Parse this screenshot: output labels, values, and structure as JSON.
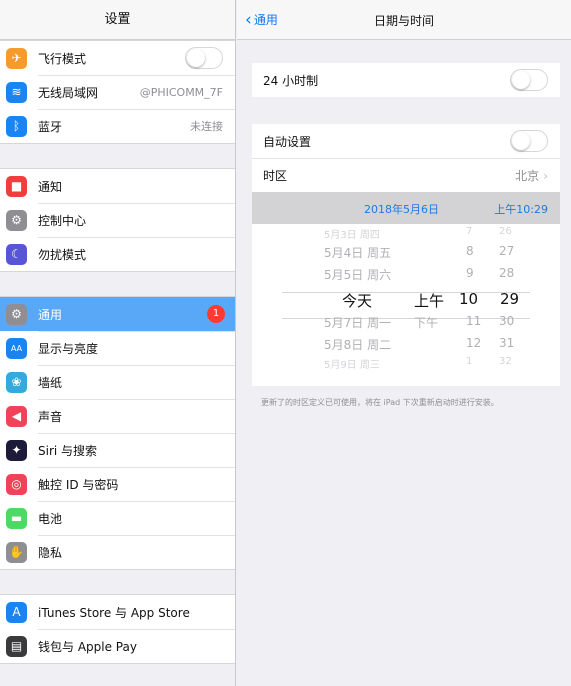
{
  "left": {
    "title": "设置",
    "groups": [
      [
        {
          "label": "飞行模式",
          "icon": "airplane-icon",
          "color": "#f59b2e",
          "glyph": "✈",
          "toggle": true
        },
        {
          "label": "无线局域网",
          "icon": "wifi-icon",
          "color": "#1a84f2",
          "glyph": "≋",
          "value": "@PHICOMM_7F"
        },
        {
          "label": "蓝牙",
          "icon": "bluetooth-icon",
          "color": "#1a84f2",
          "glyph": "ᛒ",
          "value": "未连接"
        }
      ],
      [
        {
          "label": "通知",
          "icon": "notifications-icon",
          "color": "#f03d3d",
          "glyph": "■"
        },
        {
          "label": "控制中心",
          "icon": "control-center-icon",
          "color": "#8e8e93",
          "glyph": "⚙"
        },
        {
          "label": "勿扰模式",
          "icon": "do-not-disturb-icon",
          "color": "#5856d6",
          "glyph": "☾"
        }
      ],
      [
        {
          "label": "通用",
          "icon": "general-icon",
          "color": "#8e8e93",
          "glyph": "⚙",
          "badge": "1",
          "selected": true
        },
        {
          "label": "显示与亮度",
          "icon": "display-brightness-icon",
          "color": "#1a84f2",
          "glyph": "AA"
        },
        {
          "label": "墙纸",
          "icon": "wallpaper-icon",
          "color": "#34aadc",
          "glyph": "❀"
        },
        {
          "label": "声音",
          "icon": "sounds-icon",
          "color": "#f0435a",
          "glyph": "◀"
        },
        {
          "label": "Siri 与搜索",
          "icon": "siri-icon",
          "color": "#1c1c3a",
          "glyph": "✦"
        },
        {
          "label": "触控 ID 与密码",
          "icon": "touch-id-icon",
          "color": "#f0435a",
          "glyph": "◎"
        },
        {
          "label": "电池",
          "icon": "battery-icon",
          "color": "#4cd964",
          "glyph": "▬"
        },
        {
          "label": "隐私",
          "icon": "privacy-icon",
          "color": "#8e8e93",
          "glyph": "✋"
        }
      ],
      [
        {
          "label": "iTunes Store 与 App Store",
          "icon": "app-store-icon",
          "color": "#1a84f2",
          "glyph": "A"
        },
        {
          "label": "钱包与 Apple Pay",
          "icon": "wallet-icon",
          "color": "#3a3a3c",
          "glyph": "▤"
        }
      ]
    ]
  },
  "right": {
    "back_label": "通用",
    "title": "日期与时间",
    "hour24_label": "24 小时制",
    "auto_label": "自动设置",
    "timezone_label": "时区",
    "timezone_value": "北京",
    "selected_date": "2018年5月6日",
    "selected_time": "上午10:29",
    "picker": {
      "rows": [
        {
          "day": "5月3日 周四",
          "ampm": "",
          "hour": "7",
          "minute": "26",
          "style": "faint"
        },
        {
          "day": "5月4日 周五",
          "ampm": "",
          "hour": "8",
          "minute": "27",
          "style": "dim"
        },
        {
          "day": "5月5日 周六",
          "ampm": "",
          "hour": "9",
          "minute": "28",
          "style": "dim"
        },
        {
          "day": "今天",
          "ampm": "上午",
          "hour": "10",
          "minute": "29",
          "style": "sel"
        },
        {
          "day": "5月7日 周一",
          "ampm": "下午",
          "hour": "11",
          "minute": "30",
          "style": "dim"
        },
        {
          "day": "5月8日 周二",
          "ampm": "",
          "hour": "12",
          "minute": "31",
          "style": "dim"
        },
        {
          "day": "5月9日 周三",
          "ampm": "",
          "hour": "1",
          "minute": "32",
          "style": "faint"
        }
      ]
    },
    "footnote": "更新了的时区定义已可使用，将在 iPad 下次重新启动时进行安装。"
  },
  "colors": {
    "accent": "#0a7aff",
    "selected_row": "#59a8f7",
    "badge": "#ff3b30"
  }
}
